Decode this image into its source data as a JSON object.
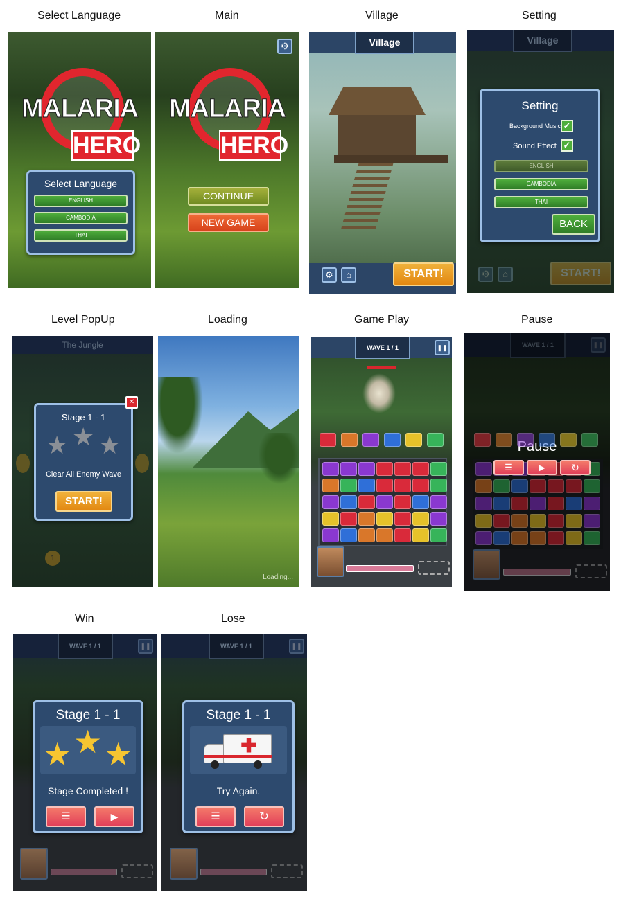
{
  "captions": {
    "select_language": "Select Language",
    "main": "Main",
    "village": "Village",
    "setting": "Setting",
    "level_popup": "Level PopUp",
    "loading": "Loading",
    "game_play": "Game Play",
    "pause": "Pause",
    "win": "Win",
    "lose": "Lose"
  },
  "logo": {
    "line1": "MALARIA",
    "line2": "HERO"
  },
  "select_language": {
    "title": "Select Language",
    "options": [
      "ENGLISH",
      "CAMBODIA",
      "THAI"
    ]
  },
  "main": {
    "continue_label": "CONTINUE",
    "new_game_label": "NEW GAME"
  },
  "village": {
    "title": "Village",
    "start_label": "START!"
  },
  "setting": {
    "bg_title": "Village",
    "title": "Setting",
    "background_music_label": "Background Music",
    "sound_effect_label": "Sound Effect",
    "background_music_checked": true,
    "sound_effect_checked": true,
    "languages": [
      "ENGLISH",
      "CAMBODIA",
      "THAI"
    ],
    "back_label": "BACK",
    "start_label": "START!"
  },
  "level_popup": {
    "bg_title": "The Jungle",
    "stage": "Stage 1 - 1",
    "stars_earned": 0,
    "stars_total": 3,
    "objective": "Clear All Enemy Wave",
    "start_label": "START!",
    "close_symbol": "✕",
    "stage_marker": "1"
  },
  "loading": {
    "text": "Loading..."
  },
  "gameplay": {
    "wave": "WAVE 1 / 1",
    "top_row": [
      "r",
      "o",
      "p",
      "b",
      "y",
      "g"
    ],
    "board": [
      [
        "p",
        "p",
        "p",
        "r",
        "r",
        "r",
        "g"
      ],
      [
        "o",
        "g",
        "b",
        "r",
        "r",
        "r",
        "g"
      ],
      [
        "p",
        "b",
        "r",
        "p",
        "r",
        "b",
        "p"
      ],
      [
        "y",
        "r",
        "o",
        "y",
        "r",
        "y",
        "p"
      ],
      [
        "p",
        "b",
        "o",
        "o",
        "r",
        "y",
        "g"
      ]
    ]
  },
  "pause": {
    "wave": "WAVE 1 / 1",
    "title": "Pause"
  },
  "win": {
    "wave": "WAVE 1 / 1",
    "stage": "Stage 1 - 1",
    "stars_earned": 3,
    "stars_total": 3,
    "message": "Stage Completed !"
  },
  "lose": {
    "wave": "WAVE 1 / 1",
    "stage": "Stage 1 - 1",
    "message": "Try Again."
  },
  "icons": {
    "settings": "⚙",
    "home": "⌂",
    "pause": "❚❚",
    "list": "☰",
    "play": "▶",
    "restart": "↻",
    "check": "✓",
    "star": "★",
    "cross": "✚"
  },
  "colors": {
    "panel": "#2d4a6e",
    "panel_border": "#9ec0e6",
    "green_button": "#4fae3c",
    "orange_button": "#f0b13a",
    "red_button": "#e1262e",
    "star_gold": "#f6c531",
    "star_grey": "#8a8f96"
  }
}
